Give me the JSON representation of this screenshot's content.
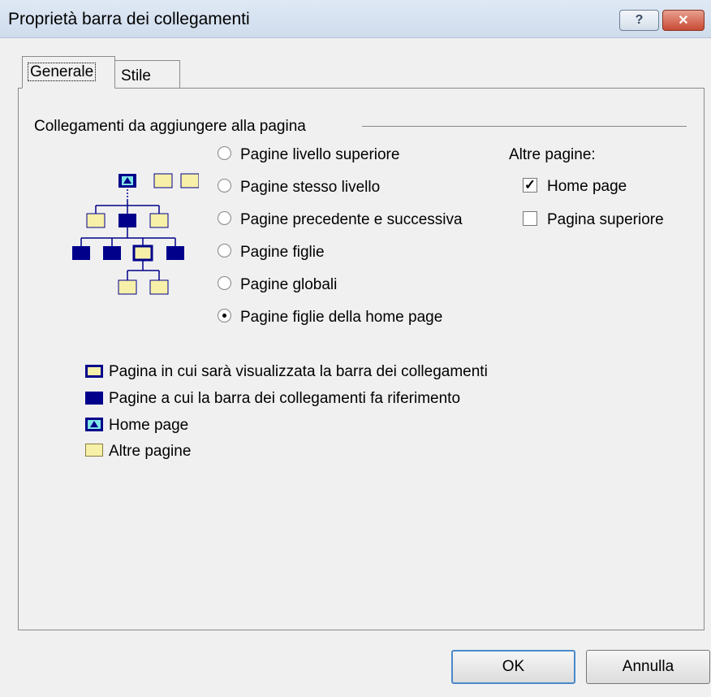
{
  "window": {
    "title": "Proprietà barra dei collegamenti",
    "help_glyph": "?",
    "close_glyph": "✕"
  },
  "tabs": [
    {
      "label": "Generale",
      "active": true
    },
    {
      "label": "Stile",
      "active": false
    }
  ],
  "group_title": "Collegamenti da aggiungere alla pagina",
  "radio_options": [
    {
      "label": "Pagine livello superiore",
      "checked": false
    },
    {
      "label": "Pagine stesso livello",
      "checked": false
    },
    {
      "label": "Pagine precedente e successiva",
      "checked": false
    },
    {
      "label": "Pagine figlie",
      "checked": false
    },
    {
      "label": "Pagine globali",
      "checked": false
    },
    {
      "label": "Pagine figlie della home page",
      "checked": true
    }
  ],
  "other_pages": {
    "title": "Altre pagine:",
    "options": [
      {
        "label": "Home page",
        "checked": true
      },
      {
        "label": "Pagina superiore",
        "checked": false
      }
    ]
  },
  "legend": [
    {
      "label": "Pagina in cui sarà visualizzata la barra dei collegamenti",
      "icon": "current-page-icon"
    },
    {
      "label": "Pagine a cui la barra dei collegamenti fa riferimento",
      "icon": "linked-page-icon"
    },
    {
      "label": "Home page",
      "icon": "home-page-icon"
    },
    {
      "label": "Altre pagine",
      "icon": "other-page-icon"
    }
  ],
  "buttons": {
    "ok": "OK",
    "cancel": "Annulla"
  },
  "colors": {
    "linked_page": "#00008b",
    "other_page": "#f7f0a8",
    "accent": "#4a89c9"
  },
  "check_glyph": "✓"
}
